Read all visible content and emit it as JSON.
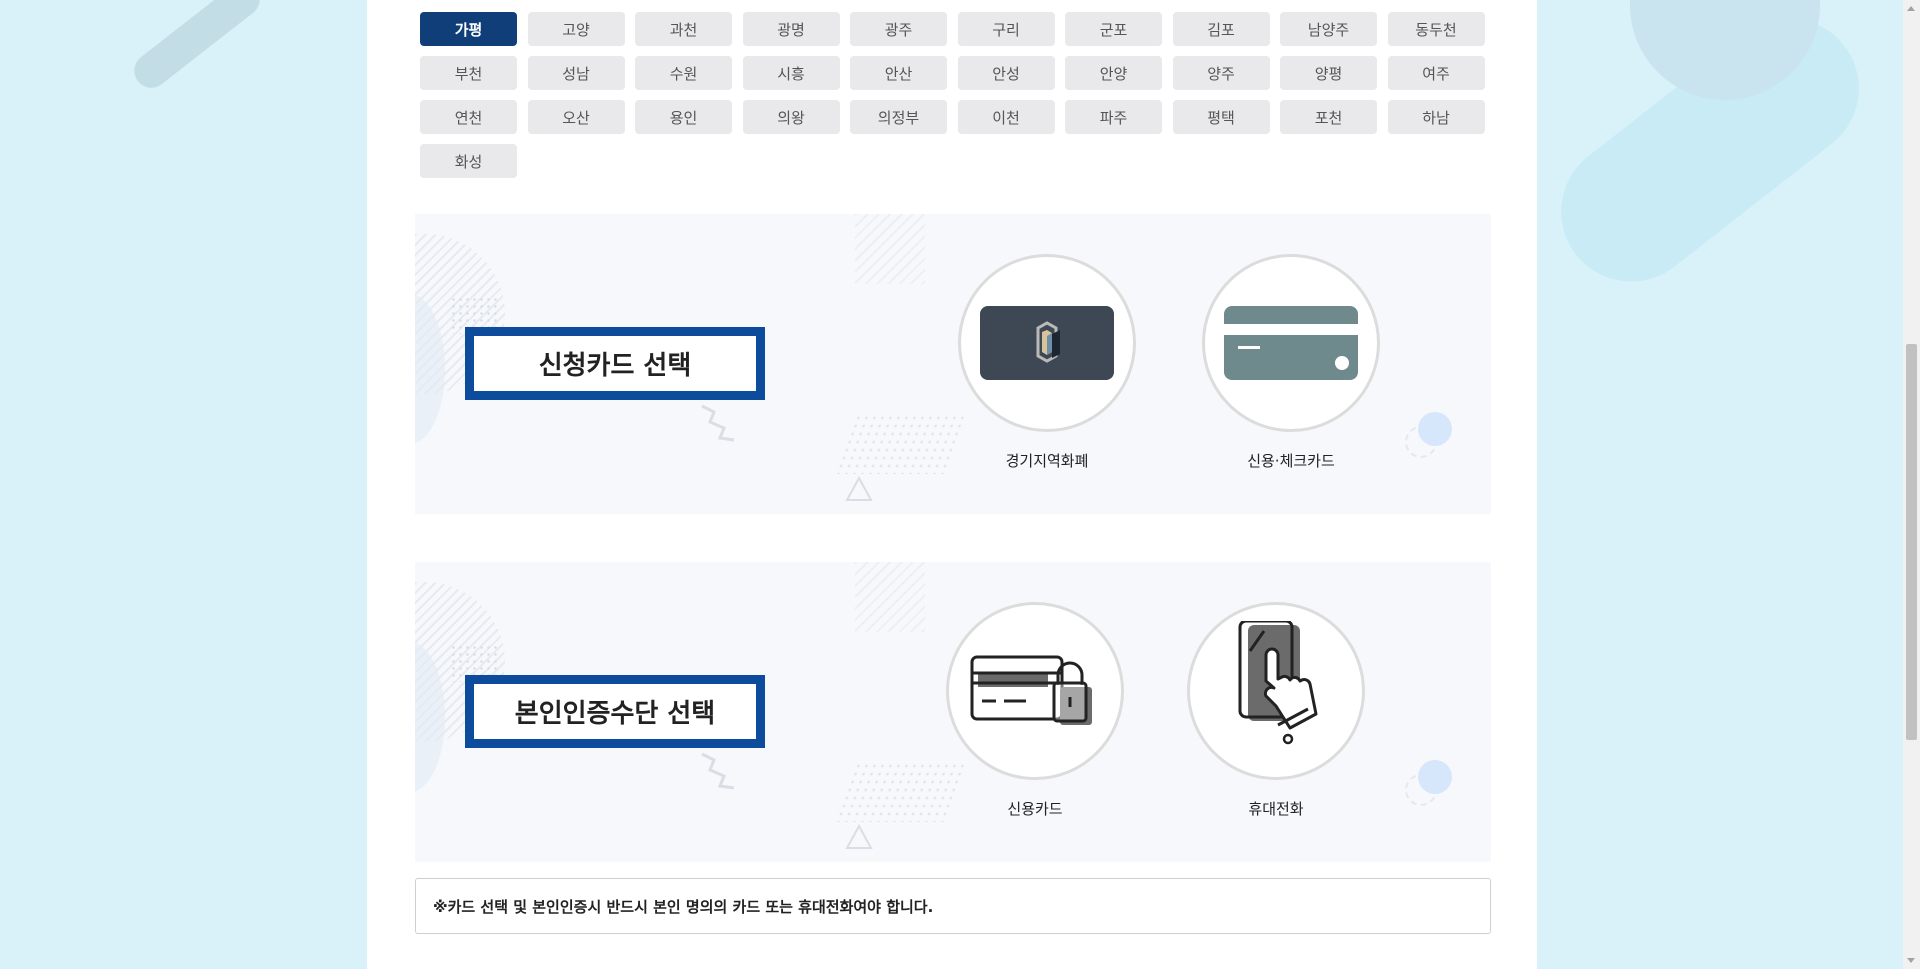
{
  "regions": [
    "가평",
    "고양",
    "과천",
    "광명",
    "광주",
    "구리",
    "군포",
    "김포",
    "남양주",
    "동두천",
    "부천",
    "성남",
    "수원",
    "시흥",
    "안산",
    "안성",
    "안양",
    "양주",
    "양평",
    "여주",
    "연천",
    "오산",
    "용인",
    "의왕",
    "의정부",
    "이천",
    "파주",
    "평택",
    "포천",
    "하남",
    "화성"
  ],
  "selected_region": "가평",
  "card_section": {
    "title": "신청카드 선택",
    "options": [
      {
        "label": "경기지역화폐",
        "icon": "local-currency-card-icon"
      },
      {
        "label": "신용·체크카드",
        "icon": "credit-check-card-icon"
      }
    ]
  },
  "auth_section": {
    "title": "본인인증수단 선택",
    "options": [
      {
        "label": "신용카드",
        "icon": "credit-card-lock-icon"
      },
      {
        "label": "휴대전화",
        "icon": "mobile-phone-touch-icon"
      }
    ]
  },
  "notice": "※카드 선택 및 본인인증시 반드시 본인 명의의 카드 또는 휴대전화여야 합니다.",
  "colors": {
    "accent": "#0d4b9c",
    "active_region": "#0f3e78",
    "page_bg": "#d9f1f8"
  }
}
